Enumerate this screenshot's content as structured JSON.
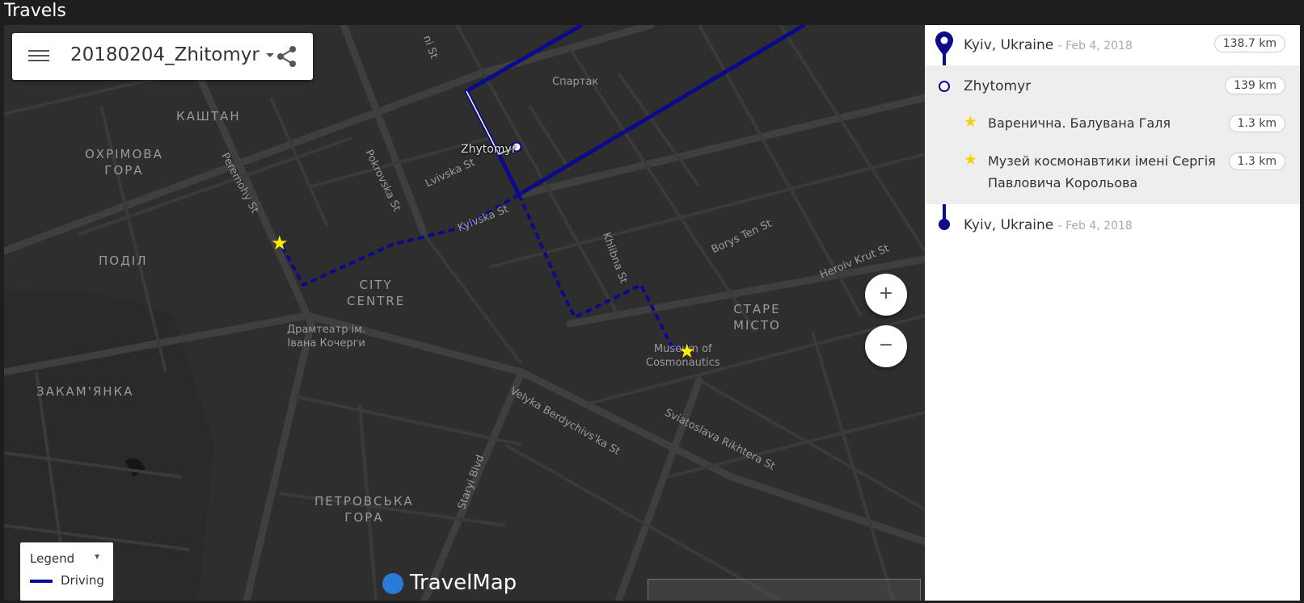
{
  "app": {
    "title": "Travels"
  },
  "trip": {
    "name": "20180204_Zhitomyr"
  },
  "map": {
    "districts": [
      {
        "key": "kashtan",
        "text": "КАШТАН"
      },
      {
        "key": "okhrimova",
        "text": "ОХРІМОВА\nГОРА"
      },
      {
        "key": "podil",
        "text": "ПОДІЛ"
      },
      {
        "key": "city-centre",
        "text": "CITY\nCENTRE"
      },
      {
        "key": "stare-misto",
        "text": "СТАРЕ\nМІСТО"
      },
      {
        "key": "zakamianka",
        "text": "ЗАКАМ'ЯНКА"
      },
      {
        "key": "petrovska",
        "text": "ПЕТРОВСЬКА\nГОРА"
      },
      {
        "key": "spartak",
        "text": "Спартак"
      }
    ],
    "streets": {
      "peremohy": "Peremohy St",
      "pokrovska": "Pokrovska St",
      "lvivska": "Lvivska St",
      "kyivska": "Kyivska St",
      "khlibna": "Khlibna St",
      "borys_ten": "Borys Ten St",
      "heroiv_krut": "Heroiv Krut St",
      "velyka_berdychivska": "Velyka Berdychivs'ka St",
      "sviatoslava_rikhtera": "Sviatoslava Rikhtera St",
      "staryi_blvd": "Staryi Blvd",
      "top_street": "ni St"
    },
    "pois": {
      "dramtheatre": "Драмтеатр ім.\nІвана Кочерги",
      "museum": "Museum of\nCosmonautics"
    },
    "city_label": "Zhytomyr",
    "route_color": "#0a0a8a",
    "star_color": "#ffee00"
  },
  "controls": {
    "zoom_in": "+",
    "zoom_out": "−"
  },
  "legend": {
    "title": "Legend",
    "items": [
      {
        "label": "Driving",
        "color": "#0a0a8a"
      }
    ]
  },
  "brand": {
    "name": "TravelMap"
  },
  "itinerary": {
    "stops": [
      {
        "name": "Kyiv, Ukraine",
        "date": "- Feb 4, 2018",
        "distance": "138.7 km"
      },
      {
        "name": "Zhytomyr",
        "distance": "139 km",
        "places": [
          {
            "name": "Варенична. Балувана Галя",
            "distance": "1.3 km"
          },
          {
            "name": "Музей космонавтики імені Сергія\nПавловича Корольова",
            "distance": "1.3 km"
          }
        ]
      },
      {
        "name": "Kyiv, Ukraine",
        "date": "- Feb 4, 2018"
      }
    ]
  }
}
